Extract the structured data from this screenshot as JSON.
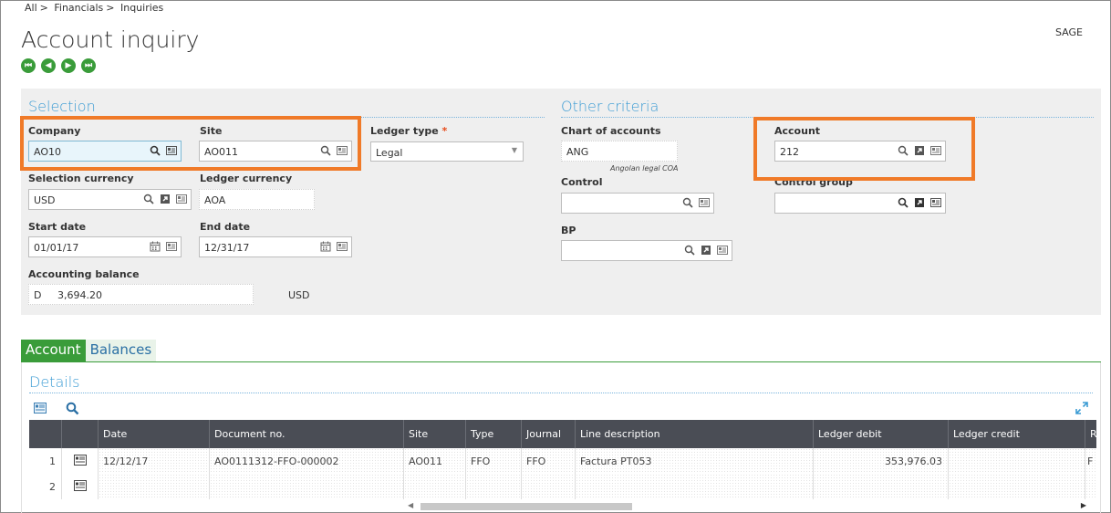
{
  "breadcrumb": [
    "All",
    "Financials",
    "Inquiries"
  ],
  "breadcrumb_sep": ">",
  "title": "Account inquiry",
  "brand": "SAGE",
  "nav_icons": [
    "first-record-icon",
    "previous-record-icon",
    "next-record-icon",
    "last-record-icon"
  ],
  "nav_glyphs": [
    "⏮",
    "◀",
    "▶",
    "⏭"
  ],
  "selection": {
    "title": "Selection",
    "company": {
      "label": "Company",
      "value": "AO10"
    },
    "site": {
      "label": "Site",
      "value": "AO011"
    },
    "ledger_type": {
      "label": "Ledger type",
      "required": "*",
      "value": "Legal"
    },
    "selection_currency": {
      "label": "Selection currency",
      "value": "USD"
    },
    "ledger_currency": {
      "label": "Ledger currency",
      "value": "AOA"
    },
    "start_date": {
      "label": "Start date",
      "value": "01/01/17"
    },
    "end_date": {
      "label": "End date",
      "value": "12/31/17"
    },
    "accounting_balance": {
      "label": "Accounting balance",
      "sign": "D",
      "value": "3,694.20",
      "currency": "USD"
    }
  },
  "other_criteria": {
    "title": "Other criteria",
    "chart_of_accounts": {
      "label": "Chart of accounts",
      "value": "ANG",
      "note": "Angolan legal COA"
    },
    "account": {
      "label": "Account",
      "value": "212"
    },
    "control": {
      "label": "Control",
      "value": ""
    },
    "control_group": {
      "label": "Control group",
      "value": ""
    },
    "bp": {
      "label": "BP",
      "value": ""
    }
  },
  "tabs": [
    {
      "label": "Account",
      "active": true
    },
    {
      "label": "Balances",
      "active": false
    }
  ],
  "details": {
    "title": "Details",
    "columns": [
      "",
      "",
      "Date",
      "Document no.",
      "Site",
      "Type",
      "Journal",
      "Line description",
      "Ledger debit",
      "Ledger credit",
      "R"
    ],
    "rows": [
      {
        "num": "1",
        "date": "12/12/17",
        "doc": "AO0111312-FFO-000002",
        "site": "AO011",
        "type": "FFO",
        "journal": "FFO",
        "desc": "Factura PT053",
        "debit": "353,976.03",
        "credit": "",
        "r": "F"
      },
      {
        "num": "2",
        "date": "",
        "doc": "",
        "site": "",
        "type": "",
        "journal": "",
        "desc": "",
        "debit": "",
        "credit": "",
        "r": ""
      }
    ]
  },
  "colors": {
    "accent": "#3c9cd4",
    "highlight": "#f07a28",
    "tab_active": "#3a9c3a",
    "grid_header": "#4a4d55"
  }
}
